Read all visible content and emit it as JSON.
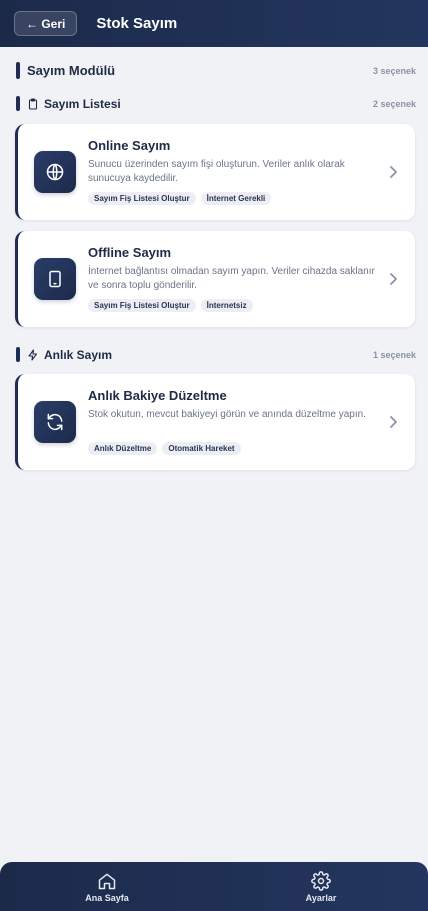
{
  "header": {
    "back_label": "← Geri",
    "title": "Stok Sayım"
  },
  "module": {
    "title": "Sayım Modülü",
    "count": "3 seçenek"
  },
  "sections": [
    {
      "title": "Sayım Listesi",
      "count": "2 seçenek",
      "icon": "clipboard-icon",
      "cards": [
        {
          "title": "Online Sayım",
          "desc": "Sunucu üzerinden sayım fişi oluşturun. Veriler anlık olarak sunucuya kaydedilir.",
          "icon": "globe-icon",
          "tags": [
            "Sayım Fiş Listesi Oluştur",
            "İnternet Gerekli"
          ]
        },
        {
          "title": "Offline Sayım",
          "desc": "İnternet bağlantısı olmadan sayım yapın. Veriler cihazda saklanır ve sonra toplu gönderilir.",
          "icon": "tablet-icon",
          "tags": [
            "Sayım Fiş Listesi Oluştur",
            "İnternetsiz"
          ]
        }
      ]
    },
    {
      "title": "Anlık Sayım",
      "count": "1 seçenek",
      "icon": "lightning-icon",
      "cards": [
        {
          "title": "Anlık Bakiye Düzeltme",
          "desc": "Stok okutun, mevcut bakiyeyi görün ve anında düzeltme yapın.",
          "icon": "refresh-icon",
          "tags": [
            "Anlık Düzeltme",
            "Otomatik Hareket"
          ]
        }
      ]
    }
  ],
  "nav": {
    "home_label": "Ana Sayfa",
    "settings_label": "Ayarlar"
  }
}
